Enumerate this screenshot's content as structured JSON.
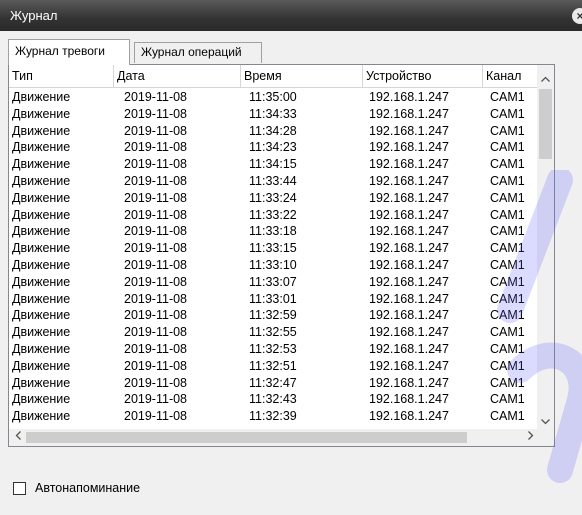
{
  "window": {
    "title": "Журнал",
    "close_label": "×"
  },
  "tabs": [
    {
      "label": "Журнал тревоги"
    },
    {
      "label": "Журнал операций"
    }
  ],
  "table": {
    "columns": [
      "Тип",
      "Дата",
      "Время",
      "Устройство",
      "Канал"
    ],
    "rows": [
      [
        "Движение",
        "2019-11-08",
        "11:35:00",
        "192.168.1.247",
        "CAM1"
      ],
      [
        "Движение",
        "2019-11-08",
        "11:34:33",
        "192.168.1.247",
        "CAM1"
      ],
      [
        "Движение",
        "2019-11-08",
        "11:34:28",
        "192.168.1.247",
        "CAM1"
      ],
      [
        "Движение",
        "2019-11-08",
        "11:34:23",
        "192.168.1.247",
        "CAM1"
      ],
      [
        "Движение",
        "2019-11-08",
        "11:34:15",
        "192.168.1.247",
        "CAM1"
      ],
      [
        "Движение",
        "2019-11-08",
        "11:33:44",
        "192.168.1.247",
        "CAM1"
      ],
      [
        "Движение",
        "2019-11-08",
        "11:33:24",
        "192.168.1.247",
        "CAM1"
      ],
      [
        "Движение",
        "2019-11-08",
        "11:33:22",
        "192.168.1.247",
        "CAM1"
      ],
      [
        "Движение",
        "2019-11-08",
        "11:33:18",
        "192.168.1.247",
        "CAM1"
      ],
      [
        "Движение",
        "2019-11-08",
        "11:33:15",
        "192.168.1.247",
        "CAM1"
      ],
      [
        "Движение",
        "2019-11-08",
        "11:33:10",
        "192.168.1.247",
        "CAM1"
      ],
      [
        "Движение",
        "2019-11-08",
        "11:33:07",
        "192.168.1.247",
        "CAM1"
      ],
      [
        "Движение",
        "2019-11-08",
        "11:33:01",
        "192.168.1.247",
        "CAM1"
      ],
      [
        "Движение",
        "2019-11-08",
        "11:32:59",
        "192.168.1.247",
        "CAM1"
      ],
      [
        "Движение",
        "2019-11-08",
        "11:32:55",
        "192.168.1.247",
        "CAM1"
      ],
      [
        "Движение",
        "2019-11-08",
        "11:32:53",
        "192.168.1.247",
        "CAM1"
      ],
      [
        "Движение",
        "2019-11-08",
        "11:32:51",
        "192.168.1.247",
        "CAM1"
      ],
      [
        "Движение",
        "2019-11-08",
        "11:32:47",
        "192.168.1.247",
        "CAM1"
      ],
      [
        "Движение",
        "2019-11-08",
        "11:32:43",
        "192.168.1.247",
        "CAM1"
      ],
      [
        "Движение",
        "2019-11-08",
        "11:32:39",
        "192.168.1.247",
        "CAM1"
      ]
    ]
  },
  "scrollbar": {
    "up_icon": "chevron-up-icon",
    "down_icon": "chevron-down-icon",
    "left_icon": "chevron-left-icon",
    "right_icon": "chevron-right-icon"
  },
  "reminder": {
    "label": "Автонапоминание",
    "checked": false
  },
  "colors": {
    "titlebar": "#333333",
    "watermark": "#5a5aff"
  }
}
